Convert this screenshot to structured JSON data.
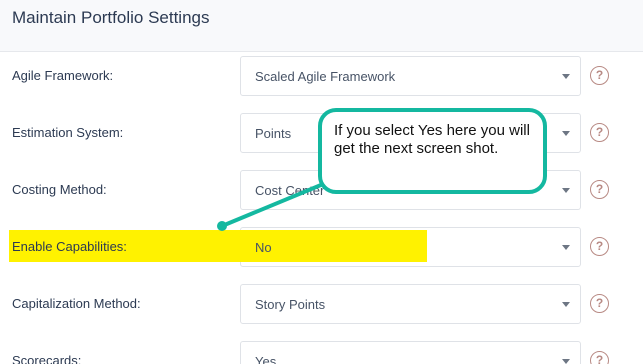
{
  "header": {
    "title": "Maintain Portfolio Settings"
  },
  "rows": [
    {
      "label": "Agile Framework:",
      "value": "Scaled Agile Framework"
    },
    {
      "label": "Estimation System:",
      "value": "Points"
    },
    {
      "label": "Costing Method:",
      "value": "Cost Center"
    },
    {
      "label": "Enable Capabilities:",
      "value": "No"
    },
    {
      "label": "Capitalization Method:",
      "value": "Story Points"
    },
    {
      "label": "Scorecards:",
      "value": "Yes"
    }
  ],
  "help_glyph": "?",
  "callout": {
    "text": "If you select Yes here you will get the next screen shot."
  },
  "colors": {
    "highlight": "#fff200",
    "callout_border": "#14b8a0",
    "help_icon": "#b88a84"
  }
}
